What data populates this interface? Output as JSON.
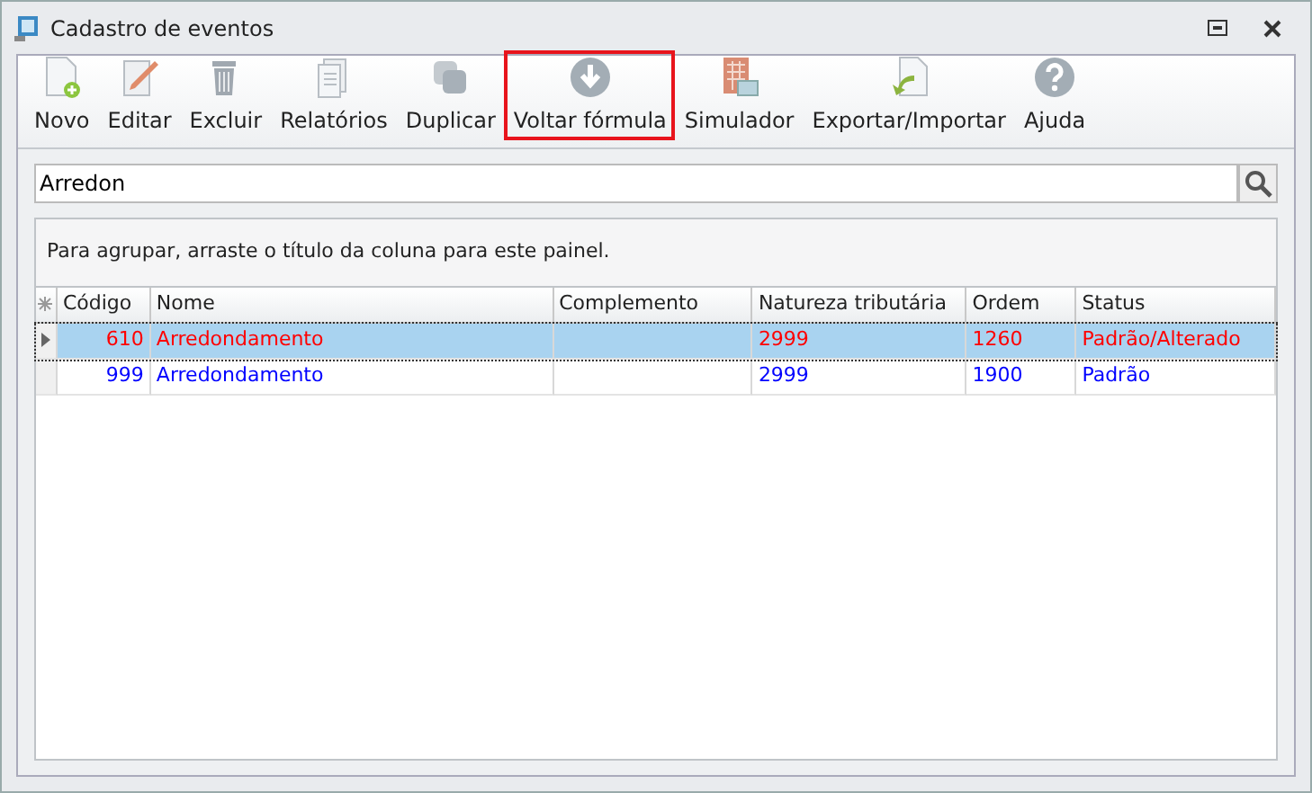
{
  "window": {
    "title": "Cadastro de eventos"
  },
  "toolbar": [
    {
      "label": "Novo",
      "highlighted": false
    },
    {
      "label": "Editar",
      "highlighted": false
    },
    {
      "label": "Excluir",
      "highlighted": false
    },
    {
      "label": "Relatórios",
      "highlighted": false
    },
    {
      "label": "Duplicar",
      "highlighted": false
    },
    {
      "label": "Voltar fórmula",
      "highlighted": true
    },
    {
      "label": "Simulador",
      "highlighted": false
    },
    {
      "label": "Exportar/Importar",
      "highlighted": false
    },
    {
      "label": "Ajuda",
      "highlighted": false
    }
  ],
  "search": {
    "value": "Arredon"
  },
  "group_panel": {
    "hint": "Para agrupar, arraste o título da coluna para este painel."
  },
  "table": {
    "columns": [
      "Código",
      "Nome",
      "Complemento",
      "Natureza tributária",
      "Ordem",
      "Status"
    ],
    "rows": [
      {
        "cells": [
          "610",
          "Arredondamento",
          "",
          "2999",
          "1260",
          "Padrão/Alterado"
        ],
        "color": "#ff0000",
        "selected": true
      },
      {
        "cells": [
          "999",
          "Arredondamento",
          "",
          "2999",
          "1900",
          "Padrão"
        ],
        "color": "#0000ff",
        "selected": false
      }
    ]
  }
}
